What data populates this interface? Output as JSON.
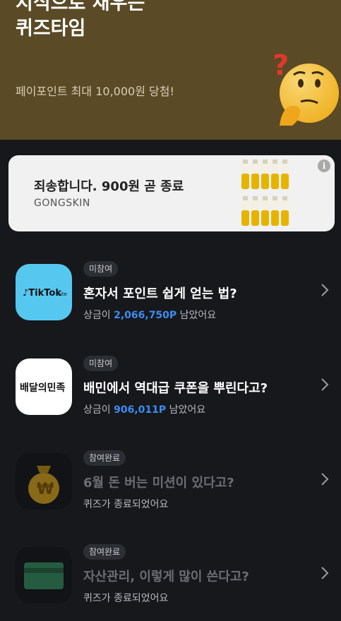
{
  "header": {
    "title_line1": "지식으로 채우는",
    "title_line2": "퀴즈타임",
    "subtitle": "페이포인트 최대 10,000원 당첨!"
  },
  "ad": {
    "title": "죄송합니다. 900원 곧 종료",
    "brand": "GONGSKIN",
    "info_glyph": "i"
  },
  "quizzes": [
    {
      "status": "미참여",
      "logo": "TikTok Lite",
      "question": "혼자서 포인트 쉽게 얻는 법?",
      "prize_prefix": "상금이 ",
      "prize_amount": "2,066,750P",
      "prize_suffix": " 남았어요"
    },
    {
      "status": "미참여",
      "logo": "배달의민족",
      "question": "배민에서 역대급 쿠폰을 뿌린다고?",
      "prize_prefix": "상금이 ",
      "prize_amount": "906,011P",
      "prize_suffix": " 남았어요"
    },
    {
      "status": "참여완료",
      "logo": "money-bag-icon",
      "question": "6월 돈 버는 미션이 있다고?",
      "ended": "퀴즈가 종료되었어요"
    },
    {
      "status": "참여완료",
      "logo": "card-icon",
      "question": "자산관리, 이렇게 많이 쓴다고?",
      "ended": "퀴즈가 종료되었어요"
    }
  ],
  "colors": {
    "header_bg": "#5b4a26",
    "page_bg": "#16181c",
    "prize_blue": "#3d8cf0"
  }
}
